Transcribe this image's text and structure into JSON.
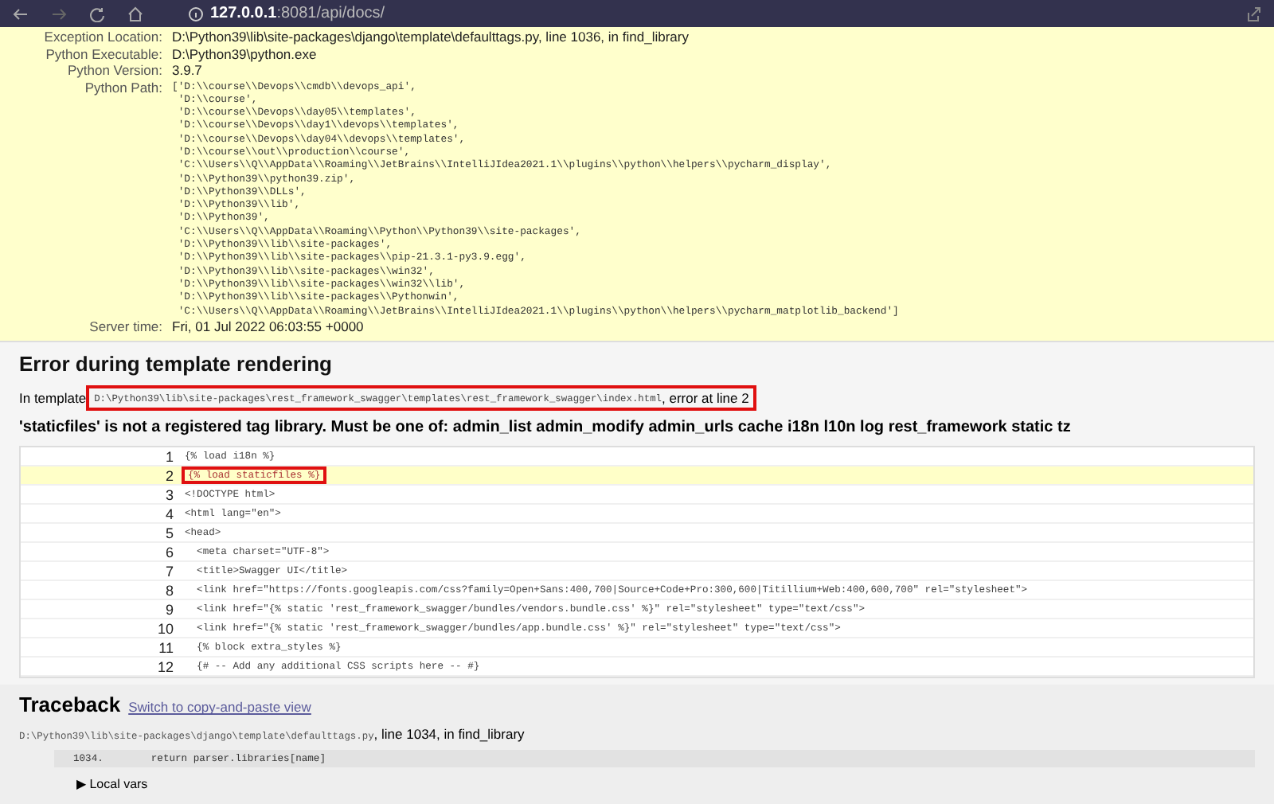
{
  "browser": {
    "url_host": "127.0.0.1",
    "url_path": ":8081/api/docs/"
  },
  "meta": [
    {
      "label": "Exception Location:",
      "value": "D:\\Python39\\lib\\site-packages\\django\\template\\defaulttags.py, line 1036, in find_library",
      "kind": "text"
    },
    {
      "label": "Python Executable:",
      "value": "D:\\Python39\\python.exe",
      "kind": "text"
    },
    {
      "label": "Python Version:",
      "value": "3.9.7",
      "kind": "text"
    },
    {
      "label": "Python Path:",
      "kind": "code",
      "lines": [
        "['D:\\\\course\\\\Devops\\\\cmdb\\\\devops_api',",
        " 'D:\\\\course',",
        " 'D:\\\\course\\\\Devops\\\\day05\\\\templates',",
        " 'D:\\\\course\\\\Devops\\\\day1\\\\devops\\\\templates',",
        " 'D:\\\\course\\\\Devops\\\\day04\\\\devops\\\\templates',",
        " 'D:\\\\course\\\\out\\\\production\\\\course',",
        " 'C:\\\\Users\\\\Q\\\\AppData\\\\Roaming\\\\JetBrains\\\\IntelliJIdea2021.1\\\\plugins\\\\python\\\\helpers\\\\pycharm_display',",
        " 'D:\\\\Python39\\\\python39.zip',",
        " 'D:\\\\Python39\\\\DLLs',",
        " 'D:\\\\Python39\\\\lib',",
        " 'D:\\\\Python39',",
        " 'C:\\\\Users\\\\Q\\\\AppData\\\\Roaming\\\\Python\\\\Python39\\\\site-packages',",
        " 'D:\\\\Python39\\\\lib\\\\site-packages',",
        " 'D:\\\\Python39\\\\lib\\\\site-packages\\\\pip-21.3.1-py3.9.egg',",
        " 'D:\\\\Python39\\\\lib\\\\site-packages\\\\win32',",
        " 'D:\\\\Python39\\\\lib\\\\site-packages\\\\win32\\\\lib',",
        " 'D:\\\\Python39\\\\lib\\\\site-packages\\\\Pythonwin',",
        " 'C:\\\\Users\\\\Q\\\\AppData\\\\Roaming\\\\JetBrains\\\\IntelliJIdea2021.1\\\\plugins\\\\python\\\\helpers\\\\pycharm_matplotlib_backend']"
      ]
    },
    {
      "label": "Server time:",
      "value": "Fri, 01 Jul 2022 06:03:55 +0000",
      "kind": "text"
    }
  ],
  "template_error": {
    "title": "Error during template rendering",
    "prefix": "In template",
    "path": "D:\\Python39\\lib\\site-packages\\rest_framework_swagger\\templates\\rest_framework_swagger\\index.html",
    "suffix": ", error at line 2",
    "boxed": true,
    "message": "'staticfiles' is not a registered tag library. Must be one of: admin_list admin_modify admin_urls cache i18n l10n log rest_framework static tz",
    "lines": [
      {
        "number": "1",
        "code": "{% load i18n %}",
        "highlighted": false
      },
      {
        "number": "2",
        "code": "{% load staticfiles %}",
        "highlighted": true
      },
      {
        "number": "3",
        "code": "<!DOCTYPE html>",
        "highlighted": false
      },
      {
        "number": "4",
        "code": "<html lang=\"en\">",
        "highlighted": false
      },
      {
        "number": "5",
        "code": "<head>",
        "highlighted": false
      },
      {
        "number": "6",
        "code": "  <meta charset=\"UTF-8\">",
        "highlighted": false
      },
      {
        "number": "7",
        "code": "  <title>Swagger UI</title>",
        "highlighted": false
      },
      {
        "number": "8",
        "code": "  <link href=\"https://fonts.googleapis.com/css?family=Open+Sans:400,700|Source+Code+Pro:300,600|Titillium+Web:400,600,700\" rel=\"stylesheet\">",
        "highlighted": false
      },
      {
        "number": "9",
        "code": "  <link href=\"{% static 'rest_framework_swagger/bundles/vendors.bundle.css' %}\" rel=\"stylesheet\" type=\"text/css\">",
        "highlighted": false
      },
      {
        "number": "10",
        "code": "  <link href=\"{% static 'rest_framework_swagger/bundles/app.bundle.css' %}\" rel=\"stylesheet\" type=\"text/css\">",
        "highlighted": false
      },
      {
        "number": "11",
        "code": "  {% block extra_styles %}",
        "highlighted": false
      },
      {
        "number": "12",
        "code": "  {# -- Add any additional CSS scripts here -- #}",
        "highlighted": false
      }
    ]
  },
  "traceback": {
    "title": "Traceback",
    "link": "Switch to copy-and-paste view",
    "frame_path": "D:\\Python39\\lib\\site-packages\\django\\template\\defaulttags.py",
    "frame_info": ", line 1034, in find_library",
    "line_number": "1034.",
    "line_code": "return parser.libraries[name]",
    "local_vars": "▶ Local vars"
  }
}
